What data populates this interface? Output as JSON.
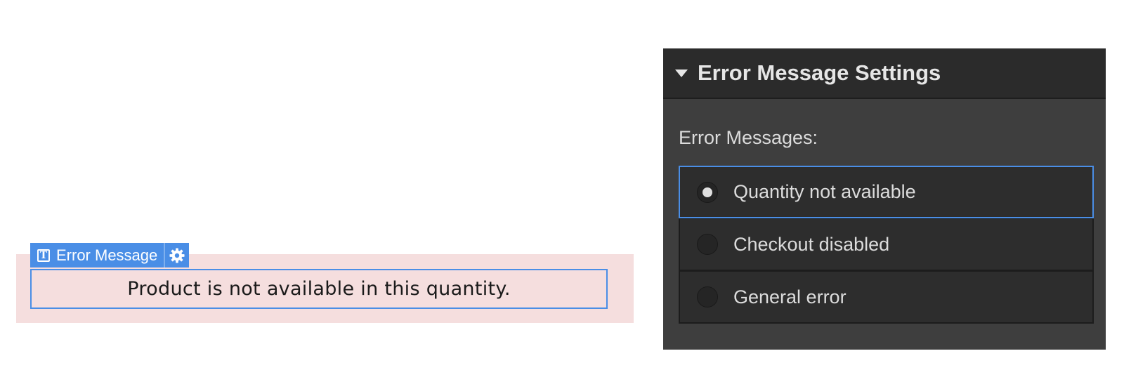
{
  "canvas": {
    "element_tag": {
      "label": "Error Message",
      "text_icon": "T",
      "type_icon": "text-icon",
      "settings_icon": "gear-icon"
    },
    "message": "Product is not available in this quantity."
  },
  "panel": {
    "title": "Error Message Settings",
    "collapse_icon": "triangle-down-icon",
    "section_label": "Error Messages:",
    "options": [
      {
        "label": "Quantity not available",
        "selected": true
      },
      {
        "label": "Checkout disabled",
        "selected": false
      },
      {
        "label": "General error",
        "selected": false
      }
    ]
  },
  "colors": {
    "selection_blue": "#4a8ee6",
    "error_background": "#f5dede",
    "panel_background": "#3e3e3e",
    "panel_header": "#2b2b2b"
  }
}
